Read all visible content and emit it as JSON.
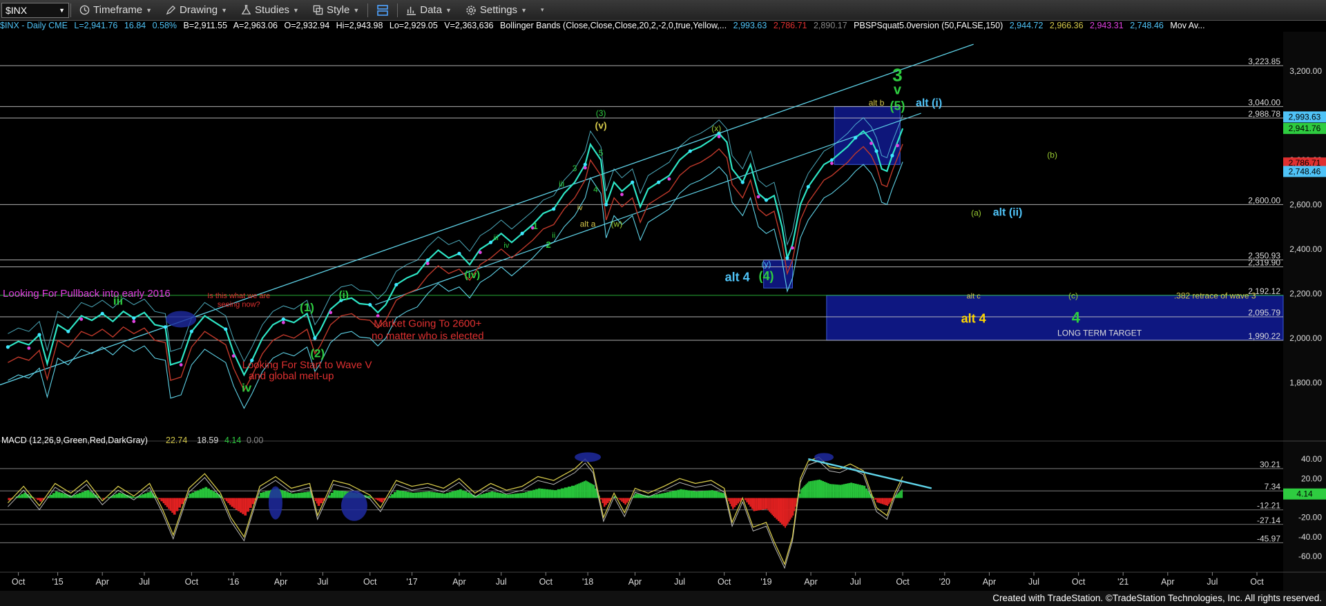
{
  "toolbar": {
    "symbol": "$INX",
    "timeframe": "Timeframe",
    "drawing": "Drawing",
    "studies": "Studies",
    "style": "Style",
    "data": "Data",
    "settings": "Settings"
  },
  "infobar": {
    "name": "$INX - Daily  CME",
    "last": "L=2,941.76",
    "change": "16.84",
    "pct": "0.58%",
    "bid": "B=2,911.55",
    "ask": "A=2,963.06",
    "open": "O=2,932.94",
    "hi": "Hi=2,943.98",
    "lo": "Lo=2,929.05",
    "vol": "V=2,363,636",
    "bb_label": "Bollinger Bands (Close,Close,Close,20,2,-2,0,true,Yellow,...",
    "bb_v1": "2,993.63",
    "bb_v2": "2,786.71",
    "bb_v3": "2,890.17",
    "pbs_label": "PBSPSquat5.0version (50,FALSE,150)",
    "pbs_v1": "2,944.72",
    "pbs_v2": "2,966.36",
    "pbs_v3": "2,943.31",
    "pbs_v4": "2,748.46",
    "mov": "Mov Av..."
  },
  "macd_header": {
    "label": "MACD (12,26,9,Green,Red,DarkGray)",
    "v1": "22.74",
    "v2": "18.59",
    "v3": "4.14",
    "v4": "0.00"
  },
  "footer": "Created with TradeStation. ©TradeStation Technologies, Inc. All rights reserved.",
  "chart_data": {
    "type": "line",
    "price_axis": {
      "ylim": [
        1550,
        3370
      ],
      "tick_labels": [
        "3,200.00",
        "2,800.00",
        "2,600.00",
        "2,400.00",
        "2,200.00",
        "2,000.00",
        "1,800.00"
      ],
      "ticks": [
        3200,
        2800,
        2600,
        2400,
        2200,
        2000,
        1800
      ]
    },
    "levels": [
      {
        "value": 3223.85,
        "label": "3,223.85"
      },
      {
        "value": 3040.0,
        "label": "3,040.00"
      },
      {
        "value": 2988.78,
        "label": "2,988.78"
      },
      {
        "value": 2600.0,
        "label": "2,600.00"
      },
      {
        "value": 2350.93,
        "label": "2,350.93"
      },
      {
        "value": 2319.9,
        "label": "2,319.90"
      },
      {
        "value": 2192.12,
        "label": "2,192.12"
      },
      {
        "value": 2095.79,
        "label": "2,095.79"
      },
      {
        "value": 1990.22,
        "label": "1,990.22"
      }
    ],
    "price_badges": [
      {
        "value": 2993.63,
        "label": "2,993.63",
        "color": "#4fc3f7"
      },
      {
        "value": 2941.76,
        "label": "2,941.76",
        "color": "#2ecc40"
      },
      {
        "value": 2786.71,
        "label": "2,786.71",
        "color": "#e03030"
      },
      {
        "value": 2748.46,
        "label": "2,748.46",
        "color": "#4fc3f7"
      }
    ],
    "x_labels": [
      {
        "label": "Oct",
        "t": 0.2
      },
      {
        "label": "'15",
        "t": 0.95
      },
      {
        "label": "Apr",
        "t": 1.8
      },
      {
        "label": "Jul",
        "t": 2.6
      },
      {
        "label": "Oct",
        "t": 3.5
      },
      {
        "label": "'16",
        "t": 4.3
      },
      {
        "label": "Apr",
        "t": 5.2
      },
      {
        "label": "Jul",
        "t": 6.0
      },
      {
        "label": "Oct",
        "t": 6.9
      },
      {
        "label": "'17",
        "t": 7.7
      },
      {
        "label": "Apr",
        "t": 8.6
      },
      {
        "label": "Jul",
        "t": 9.4
      },
      {
        "label": "Oct",
        "t": 10.25
      },
      {
        "label": "'18",
        "t": 11.05
      },
      {
        "label": "Apr",
        "t": 11.95
      },
      {
        "label": "Jul",
        "t": 12.8
      },
      {
        "label": "Oct",
        "t": 13.65
      },
      {
        "label": "'19",
        "t": 14.45
      },
      {
        "label": "Apr",
        "t": 15.3
      },
      {
        "label": "Jul",
        "t": 16.15
      },
      {
        "label": "Oct",
        "t": 17.05
      },
      {
        "label": "'20",
        "t": 17.85
      },
      {
        "label": "Apr",
        "t": 18.7
      },
      {
        "label": "Jul",
        "t": 19.55
      },
      {
        "label": "Oct",
        "t": 20.4
      },
      {
        "label": "'21",
        "t": 21.25
      },
      {
        "label": "Apr",
        "t": 22.1
      },
      {
        "label": "Jul",
        "t": 22.95
      },
      {
        "label": "Oct",
        "t": 23.8
      }
    ],
    "price_path": [
      [
        0.0,
        1960
      ],
      [
        0.2,
        1985
      ],
      [
        0.4,
        1970
      ],
      [
        0.6,
        2015
      ],
      [
        0.75,
        1885
      ],
      [
        0.95,
        2060
      ],
      [
        1.15,
        2030
      ],
      [
        1.4,
        2100
      ],
      [
        1.6,
        2080
      ],
      [
        1.8,
        2110
      ],
      [
        2.0,
        2075
      ],
      [
        2.2,
        2120
      ],
      [
        2.4,
        2090
      ],
      [
        2.6,
        2115
      ],
      [
        2.8,
        2060
      ],
      [
        3.0,
        2050
      ],
      [
        3.1,
        1880
      ],
      [
        3.3,
        1895
      ],
      [
        3.5,
        2030
      ],
      [
        3.75,
        2100
      ],
      [
        3.95,
        2070
      ],
      [
        4.15,
        2040
      ],
      [
        4.3,
        1935
      ],
      [
        4.5,
        1835
      ],
      [
        4.65,
        1900
      ],
      [
        4.85,
        2000
      ],
      [
        5.05,
        2060
      ],
      [
        5.25,
        2085
      ],
      [
        5.45,
        2070
      ],
      [
        5.7,
        2110
      ],
      [
        5.85,
        2000
      ],
      [
        5.95,
        2035
      ],
      [
        6.15,
        2130
      ],
      [
        6.35,
        2170
      ],
      [
        6.55,
        2180
      ],
      [
        6.7,
        2155
      ],
      [
        6.9,
        2150
      ],
      [
        7.05,
        2115
      ],
      [
        7.2,
        2150
      ],
      [
        7.4,
        2240
      ],
      [
        7.6,
        2270
      ],
      [
        7.8,
        2290
      ],
      [
        8.0,
        2350
      ],
      [
        8.2,
        2395
      ],
      [
        8.4,
        2360
      ],
      [
        8.6,
        2380
      ],
      [
        8.8,
        2330
      ],
      [
        9.0,
        2400
      ],
      [
        9.2,
        2430
      ],
      [
        9.4,
        2470
      ],
      [
        9.6,
        2430
      ],
      [
        9.8,
        2470
      ],
      [
        10.0,
        2510
      ],
      [
        10.2,
        2560
      ],
      [
        10.4,
        2580
      ],
      [
        10.6,
        2650
      ],
      [
        10.8,
        2700
      ],
      [
        11.0,
        2780
      ],
      [
        11.1,
        2870
      ],
      [
        11.3,
        2800
      ],
      [
        11.4,
        2600
      ],
      [
        11.55,
        2700
      ],
      [
        11.7,
        2660
      ],
      [
        11.9,
        2700
      ],
      [
        12.05,
        2590
      ],
      [
        12.2,
        2670
      ],
      [
        12.4,
        2700
      ],
      [
        12.6,
        2730
      ],
      [
        12.8,
        2800
      ],
      [
        13.0,
        2840
      ],
      [
        13.2,
        2860
      ],
      [
        13.4,
        2890
      ],
      [
        13.55,
        2920
      ],
      [
        13.7,
        2880
      ],
      [
        13.8,
        2760
      ],
      [
        14.0,
        2700
      ],
      [
        14.15,
        2780
      ],
      [
        14.3,
        2650
      ],
      [
        14.45,
        2620
      ],
      [
        14.6,
        2640
      ],
      [
        14.75,
        2500
      ],
      [
        14.85,
        2360
      ],
      [
        14.95,
        2420
      ],
      [
        15.1,
        2600
      ],
      [
        15.25,
        2680
      ],
      [
        15.4,
        2730
      ],
      [
        15.55,
        2780
      ],
      [
        15.7,
        2800
      ],
      [
        15.85,
        2830
      ],
      [
        16.0,
        2860
      ],
      [
        16.15,
        2900
      ],
      [
        16.3,
        2930
      ],
      [
        16.45,
        2890
      ],
      [
        16.55,
        2840
      ],
      [
        16.65,
        2760
      ],
      [
        16.75,
        2750
      ],
      [
        16.85,
        2820
      ],
      [
        16.95,
        2880
      ],
      [
        17.05,
        2941.76
      ]
    ],
    "annotations": [
      {
        "text": "3",
        "t": 16.95,
        "y": 3155,
        "color": "#2ecc40",
        "size": 26,
        "bold": true
      },
      {
        "text": "v",
        "t": 16.95,
        "y": 3095,
        "color": "#2ecc40",
        "size": 20,
        "bold": true
      },
      {
        "text": "(5)",
        "t": 16.95,
        "y": 3025,
        "color": "#2ecc40",
        "size": 18,
        "bold": true
      },
      {
        "text": "alt (i)",
        "t": 17.55,
        "y": 3042,
        "color": "#4fc3f7",
        "size": 16,
        "bold": true
      },
      {
        "text": "alt b",
        "t": 16.55,
        "y": 3045,
        "color": "#d4c84a",
        "size": 12,
        "bold": false
      },
      {
        "text": "(b)",
        "t": 19.9,
        "y": 2810,
        "color": "#9acd32",
        "size": 12,
        "bold": false
      },
      {
        "text": "(a)",
        "t": 18.45,
        "y": 2550,
        "color": "#9acd32",
        "size": 12,
        "bold": false
      },
      {
        "text": "alt (ii)",
        "t": 19.05,
        "y": 2550,
        "color": "#4fc3f7",
        "size": 16,
        "bold": true
      },
      {
        "text": "(3)",
        "t": 11.3,
        "y": 2998,
        "color": "#2ecc40",
        "size": 12,
        "bold": false
      },
      {
        "text": "(v)",
        "t": 11.3,
        "y": 2940,
        "color": "#d4c84a",
        "size": 14,
        "bold": true
      },
      {
        "text": "5",
        "t": 11.3,
        "y": 2820,
        "color": "#2ecc40",
        "size": 12,
        "bold": false
      },
      {
        "text": "(x)",
        "t": 13.5,
        "y": 2930,
        "color": "#9acd32",
        "size": 12,
        "bold": false
      },
      {
        "text": "iii",
        "t": 10.55,
        "y": 2680,
        "color": "#2ecc40",
        "size": 12,
        "bold": false
      },
      {
        "text": "3",
        "t": 10.8,
        "y": 2750,
        "color": "#2ecc40",
        "size": 12,
        "bold": false
      },
      {
        "text": "4",
        "t": 11.2,
        "y": 2655,
        "color": "#2ecc40",
        "size": 12,
        "bold": false
      },
      {
        "text": "iv",
        "t": 10.9,
        "y": 2575,
        "color": "#d4c84a",
        "size": 11,
        "bold": false
      },
      {
        "text": "alt a",
        "t": 11.05,
        "y": 2500,
        "color": "#d4c84a",
        "size": 12,
        "bold": false
      },
      {
        "text": "(w)",
        "t": 11.6,
        "y": 2500,
        "color": "#9acd32",
        "size": 12,
        "bold": false
      },
      {
        "text": "1",
        "t": 10.05,
        "y": 2490,
        "color": "#2ecc40",
        "size": 13,
        "bold": true
      },
      {
        "text": "2",
        "t": 10.3,
        "y": 2405,
        "color": "#2ecc40",
        "size": 13,
        "bold": true
      },
      {
        "text": "iii",
        "t": 9.3,
        "y": 2440,
        "color": "#2ecc40",
        "size": 11,
        "bold": false
      },
      {
        "text": "iv",
        "t": 9.5,
        "y": 2405,
        "color": "#2ecc40",
        "size": 11,
        "bold": false
      },
      {
        "text": "ii",
        "t": 10.4,
        "y": 2450,
        "color": "#2ecc40",
        "size": 11,
        "bold": false
      },
      {
        "text": "(iv)",
        "t": 8.85,
        "y": 2270,
        "color": "#2ecc40",
        "size": 15,
        "bold": true
      },
      {
        "text": "alt 4",
        "t": 13.9,
        "y": 2255,
        "color": "#4fc3f7",
        "size": 18,
        "bold": true
      },
      {
        "text": "(4)",
        "t": 14.45,
        "y": 2260,
        "color": "#2ecc40",
        "size": 18,
        "bold": true
      },
      {
        "text": "(y)",
        "t": 14.45,
        "y": 2320,
        "color": "#4fc3f7",
        "size": 12,
        "bold": false
      },
      {
        "text": "Looking For Pullback into early 2016",
        "t": 1.5,
        "y": 2185,
        "color": "#e040e0",
        "size": 15,
        "bold": false
      },
      {
        "text": "iii",
        "t": 2.1,
        "y": 2150,
        "color": "#2ecc40",
        "size": 17,
        "bold": true
      },
      {
        "text": "Is this what we are",
        "t": 4.4,
        "y": 2180,
        "color": "#e03030",
        "size": 11,
        "bold": false
      },
      {
        "text": "seeing now?",
        "t": 4.4,
        "y": 2140,
        "color": "#e03030",
        "size": 11,
        "bold": false
      },
      {
        "text": "(1)",
        "t": 5.7,
        "y": 2120,
        "color": "#2ecc40",
        "size": 17,
        "bold": true
      },
      {
        "text": "(i)",
        "t": 6.4,
        "y": 2180,
        "color": "#2ecc40",
        "size": 15,
        "bold": true
      },
      {
        "text": "(2)",
        "t": 5.9,
        "y": 1915,
        "color": "#2ecc40",
        "size": 17,
        "bold": true
      },
      {
        "text": "Market Going To 2600+",
        "t": 8.0,
        "y": 2050,
        "color": "#e03030",
        "size": 15,
        "bold": false
      },
      {
        "text": "no matter who is elected",
        "t": 8.0,
        "y": 1995,
        "color": "#e03030",
        "size": 15,
        "bold": false
      },
      {
        "text": "Looking For Start to Wave V",
        "t": 5.7,
        "y": 1865,
        "color": "#e03030",
        "size": 15,
        "bold": false
      },
      {
        "text": "and global melt-up",
        "t": 5.4,
        "y": 1815,
        "color": "#e03030",
        "size": 15,
        "bold": false
      },
      {
        "text": "iv",
        "t": 4.55,
        "y": 1760,
        "color": "#2ecc40",
        "size": 17,
        "bold": true
      },
      {
        "text": "alt c",
        "t": 18.4,
        "y": 2178,
        "color": "#d4c84a",
        "size": 11,
        "bold": false
      },
      {
        "text": "(c)",
        "t": 20.3,
        "y": 2178,
        "color": "#9acd32",
        "size": 12,
        "bold": false
      },
      {
        "text": ".382 retrace of wave 3",
        "t": 23.0,
        "y": 2178,
        "color": "#d4c84a",
        "size": 12,
        "bold": false
      },
      {
        "text": "alt 4",
        "t": 18.4,
        "y": 2070,
        "color": "#ffd700",
        "size": 18,
        "bold": true
      },
      {
        "text": "4",
        "t": 20.35,
        "y": 2070,
        "color": "#2ecc40",
        "size": 22,
        "bold": true
      },
      {
        "text": "LONG TERM TARGET",
        "t": 20.8,
        "y": 2010,
        "color": "#dddddd",
        "size": 12,
        "bold": false
      }
    ],
    "macd": {
      "ylim": [
        -72,
        55
      ],
      "tick_labels": [
        "40.00",
        "20.00",
        "-20.00",
        "-40.00",
        "-60.00"
      ],
      "ticks": [
        40,
        20,
        -20,
        -40,
        -60
      ],
      "levels": [
        {
          "value": 30.21,
          "label": "30.21"
        },
        {
          "value": 7.34,
          "label": "7.34"
        },
        {
          "value": -12.21,
          "label": "-12.21"
        },
        {
          "value": -27.14,
          "label": "-27.14"
        },
        {
          "value": -45.97,
          "label": "-45.97"
        }
      ],
      "current_badge": {
        "value": 4.14,
        "label": "4.14",
        "color": "#2ecc40"
      },
      "path": [
        [
          0.0,
          -5
        ],
        [
          0.3,
          12
        ],
        [
          0.6,
          -8
        ],
        [
          0.9,
          15
        ],
        [
          1.2,
          5
        ],
        [
          1.5,
          18
        ],
        [
          1.8,
          -3
        ],
        [
          2.1,
          12
        ],
        [
          2.4,
          2
        ],
        [
          2.7,
          15
        ],
        [
          2.95,
          -12
        ],
        [
          3.15,
          -38
        ],
        [
          3.45,
          10
        ],
        [
          3.75,
          25
        ],
        [
          4.05,
          5
        ],
        [
          4.25,
          -20
        ],
        [
          4.5,
          -40
        ],
        [
          4.8,
          12
        ],
        [
          5.1,
          22
        ],
        [
          5.4,
          10
        ],
        [
          5.75,
          15
        ],
        [
          5.9,
          -18
        ],
        [
          6.2,
          18
        ],
        [
          6.5,
          14
        ],
        [
          6.9,
          3
        ],
        [
          7.1,
          -10
        ],
        [
          7.4,
          18
        ],
        [
          7.7,
          12
        ],
        [
          8.0,
          15
        ],
        [
          8.3,
          10
        ],
        [
          8.6,
          20
        ],
        [
          8.9,
          5
        ],
        [
          9.2,
          15
        ],
        [
          9.5,
          8
        ],
        [
          9.8,
          12
        ],
        [
          10.1,
          22
        ],
        [
          10.4,
          18
        ],
        [
          10.8,
          30
        ],
        [
          11.0,
          40
        ],
        [
          11.15,
          30
        ],
        [
          11.35,
          -20
        ],
        [
          11.55,
          5
        ],
        [
          11.75,
          -15
        ],
        [
          11.95,
          10
        ],
        [
          12.2,
          5
        ],
        [
          12.5,
          12
        ],
        [
          12.8,
          20
        ],
        [
          13.1,
          15
        ],
        [
          13.4,
          18
        ],
        [
          13.65,
          10
        ],
        [
          13.8,
          -25
        ],
        [
          14.0,
          0
        ],
        [
          14.2,
          -30
        ],
        [
          14.45,
          -25
        ],
        [
          14.6,
          -45
        ],
        [
          14.8,
          -68
        ],
        [
          14.95,
          -40
        ],
        [
          15.1,
          20
        ],
        [
          15.25,
          38
        ],
        [
          15.45,
          42
        ],
        [
          15.65,
          32
        ],
        [
          15.85,
          30
        ],
        [
          16.05,
          35
        ],
        [
          16.3,
          28
        ],
        [
          16.55,
          -10
        ],
        [
          16.75,
          -18
        ],
        [
          16.9,
          5
        ],
        [
          17.05,
          22
        ]
      ],
      "trendline": [
        [
          15.25,
          40
        ],
        [
          17.6,
          10
        ]
      ]
    }
  }
}
